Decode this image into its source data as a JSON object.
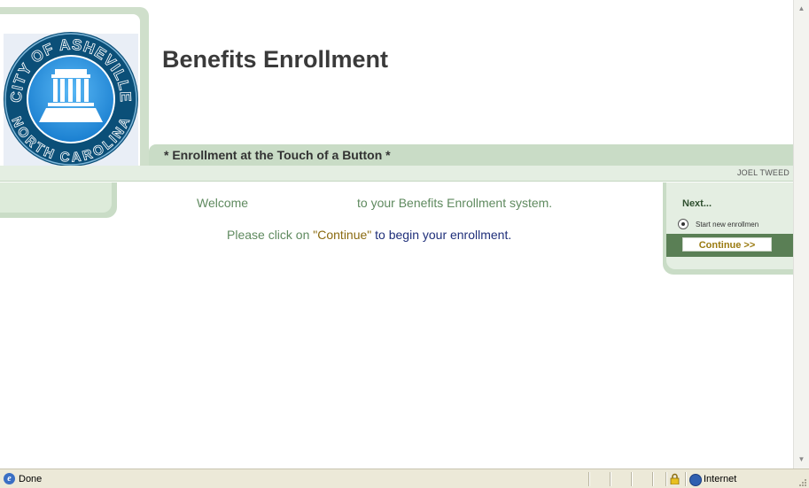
{
  "header": {
    "title": "Benefits Enrollment",
    "tagline": "* Enrollment at the Touch of a Button *",
    "user": "JOEL TWEED",
    "seal": {
      "top_text": "CITY OF ASHEVILLE",
      "bottom_text": "NORTH CAROLINA",
      "ring_color": "#0b4f78",
      "inner_color": "#1a8fe0"
    }
  },
  "main": {
    "welcome": "Welcome",
    "welcome_suffix": "to your Benefits Enrollment system.",
    "instruction_prefix": "Please click on ",
    "instruction_continue": "\"Continue\"",
    "instruction_suffix": " to begin your enrollment."
  },
  "next_panel": {
    "heading": "Next...",
    "option_label": "Start new enrollmen",
    "continue_label": "Continue >>"
  },
  "status_bar": {
    "status": "Done",
    "zone": "Internet"
  },
  "colors": {
    "accent_green": "#c9dcc6",
    "dark_green": "#5a7f55",
    "text_green": "#5f8a5f"
  }
}
